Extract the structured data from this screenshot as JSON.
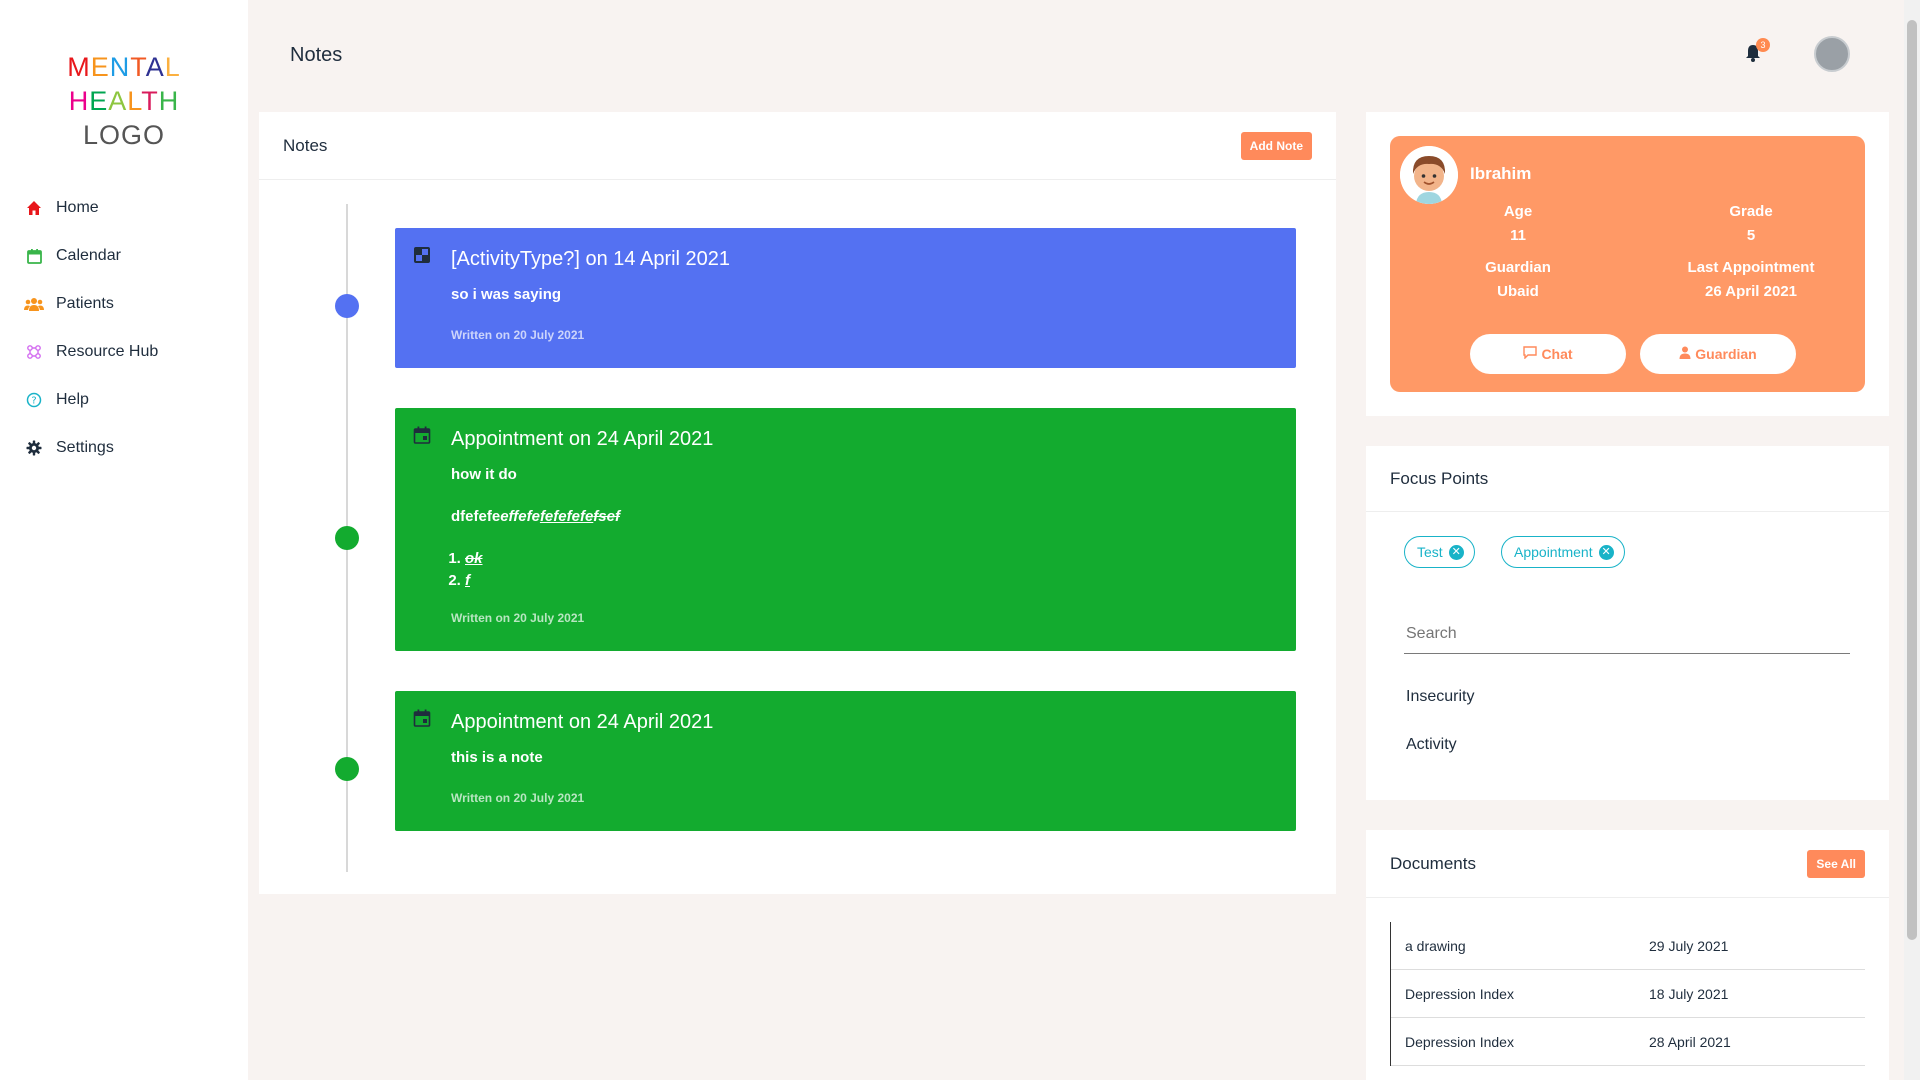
{
  "sidebar": {
    "logo": {
      "line1": [
        "M",
        "E",
        "N",
        "T",
        "A",
        "L"
      ],
      "line1_colors": [
        "#e8171b",
        "#f7941d",
        "#1e9ce5",
        "#f15a24",
        "#2e3192",
        "#fbb040"
      ],
      "line2": [
        "H",
        "E",
        "A",
        "L",
        "T",
        "H"
      ],
      "line2_colors": [
        "#ec008c",
        "#00a651",
        "#8dc63f",
        "#f7941d",
        "#d91c5c",
        "#39b54a"
      ],
      "line3": "LOGO"
    },
    "items": [
      {
        "label": "Home",
        "icon": "home-icon",
        "color": "#e8171b"
      },
      {
        "label": "Calendar",
        "icon": "calendar-icon",
        "color": "#39b54a"
      },
      {
        "label": "Patients",
        "icon": "users-icon",
        "color": "#f7941d"
      },
      {
        "label": "Resource Hub",
        "icon": "hub-icon",
        "color": "#d36cf0"
      },
      {
        "label": "Help",
        "icon": "question-icon",
        "color": "#19b3c8"
      },
      {
        "label": "Settings",
        "icon": "gear-icon",
        "color": "#1f2d3d"
      }
    ]
  },
  "header": {
    "title": "Notes",
    "notification_count": "3"
  },
  "notes": {
    "title": "Notes",
    "add_label": "Add Note",
    "entries": [
      {
        "title": "[ActivityType?] on 14 April 2021",
        "body": "so i was saying",
        "written": "Written on 20 July 2021",
        "color": "#5471f2",
        "icon": "puzzle-icon"
      },
      {
        "title": "Appointment on 24 April 2021",
        "body": "how it do",
        "body2_plain": "dfefefe",
        "body2_italic": "effefe",
        "body2_underline": "fefefefe",
        "body2_strike": "fsef",
        "list": [
          "ok",
          "f"
        ],
        "written": "Written on 20 July 2021",
        "color": "#13ab2f",
        "icon": "calendar-icon"
      },
      {
        "title": "Appointment on 24 April 2021",
        "body": "this is a note",
        "written": "Written on 20 July 2021",
        "color": "#13ab2f",
        "icon": "calendar-icon"
      }
    ]
  },
  "profile": {
    "name": "Ibrahim",
    "age_label": "Age",
    "age": "11",
    "grade_label": "Grade",
    "grade": "5",
    "guardian_label": "Guardian",
    "guardian": "Ubaid",
    "last_label": "Last Appointment",
    "last": "26 April 2021",
    "chat_label": "Chat",
    "guardian_btn_label": "Guardian"
  },
  "focus": {
    "title": "Focus Points",
    "chips": [
      "Test",
      "Appointment"
    ],
    "search_placeholder": "Search",
    "options": [
      "Insecurity",
      "Activity"
    ]
  },
  "documents": {
    "title": "Documents",
    "see_all_label": "See All",
    "rows": [
      {
        "name": "a drawing",
        "date": "29 July 2021"
      },
      {
        "name": "Depression Index",
        "date": "18 July 2021"
      },
      {
        "name": "Depression Index",
        "date": "28 April 2021"
      }
    ]
  }
}
